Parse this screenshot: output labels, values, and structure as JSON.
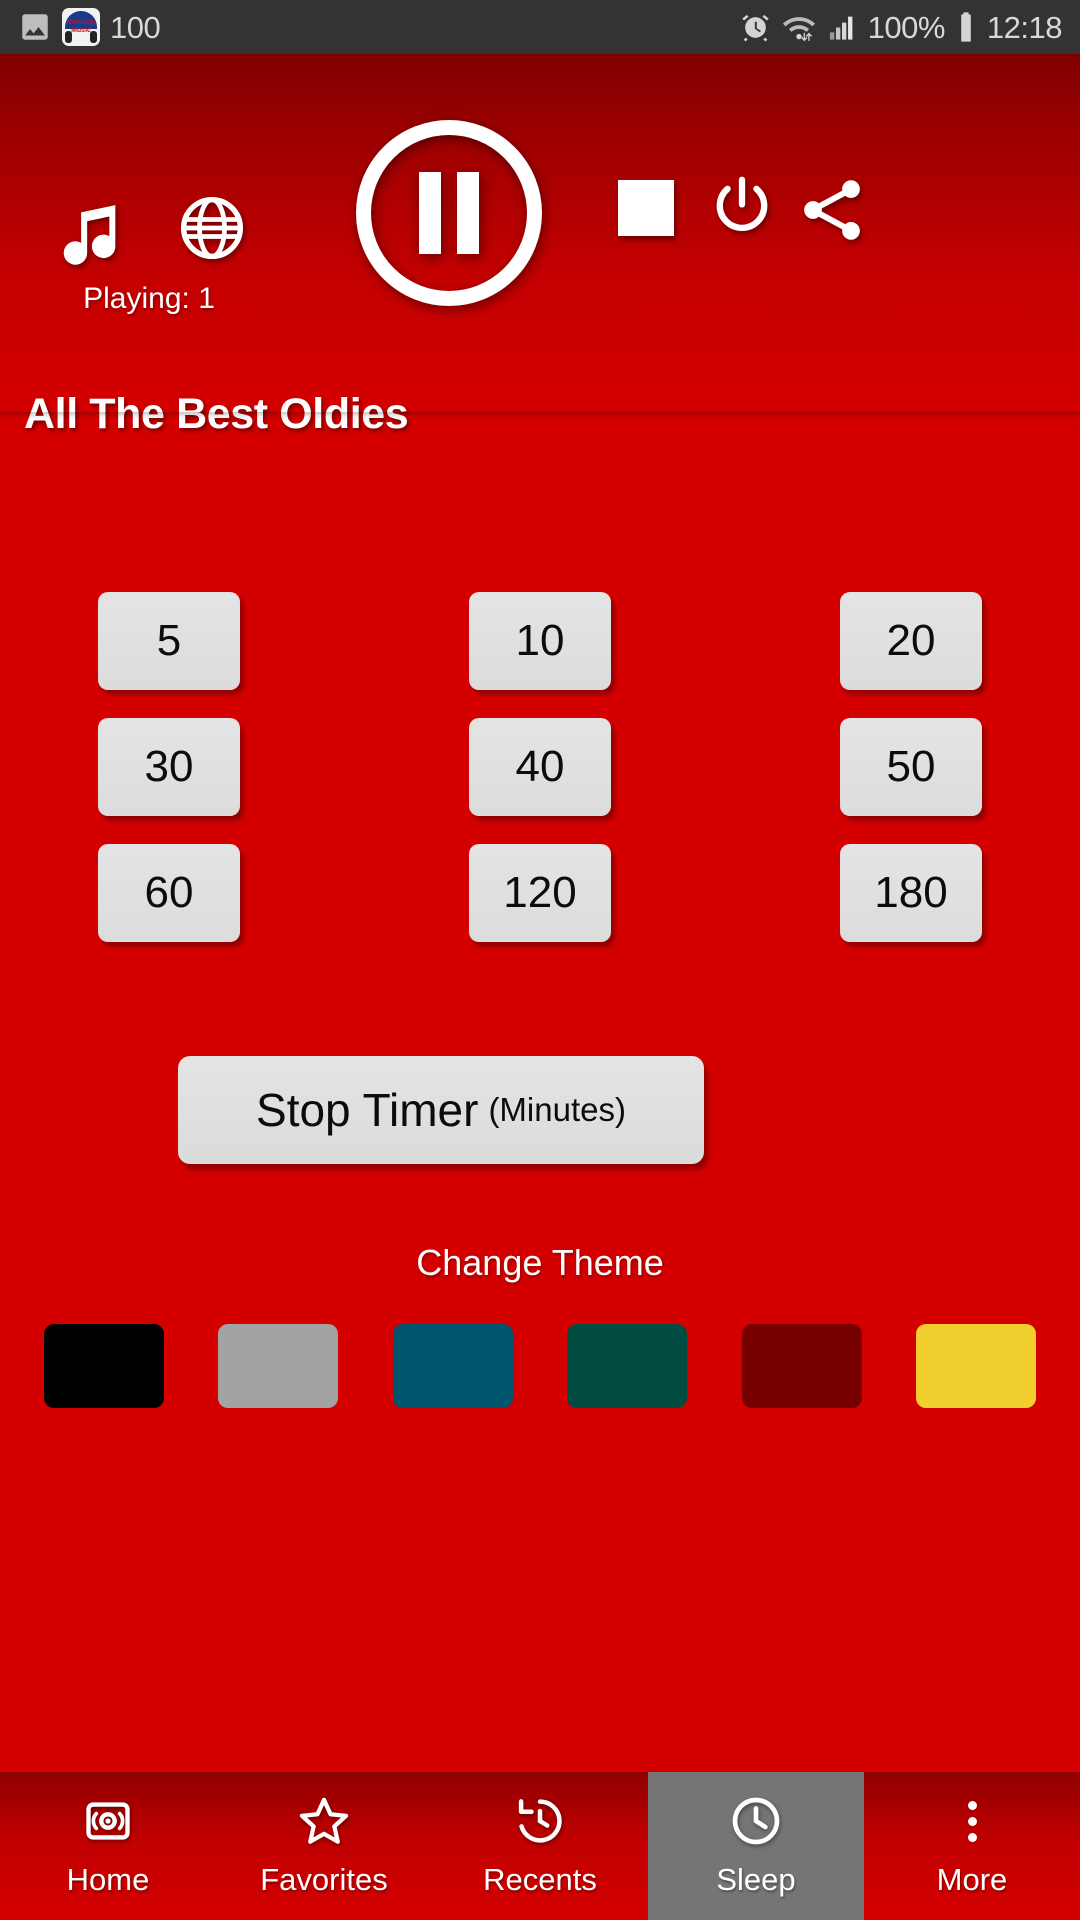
{
  "status_bar": {
    "left_icons": [
      "image-icon",
      "nonstop-music-app-icon"
    ],
    "app_badge_text": "Nonstop Music",
    "notification_count": "100",
    "right_icons": [
      "alarm-icon",
      "wifi-icon",
      "signal-icon",
      "battery-icon"
    ],
    "battery_percent": "100%",
    "clock": "12:18",
    "background": "#333333"
  },
  "player": {
    "music_icon": "music-note-icon",
    "globe_icon": "globe-icon",
    "playing_label": "Playing: 1",
    "play_button": "pause-button",
    "stop_icon": "stop-square-icon",
    "power_icon": "power-icon",
    "share_icon": "share-icon",
    "station_title": "All The Best Oldies",
    "gradient_top": "#7e0000",
    "gradient_bottom": "#d40000"
  },
  "timer": {
    "options": [
      "5",
      "10",
      "20",
      "30",
      "40",
      "50",
      "60",
      "120",
      "180"
    ],
    "stop_button_main": "Stop Timer",
    "stop_button_unit": "(Minutes)",
    "button_face": "#e0e0e0",
    "button_text": "#0c0c0c"
  },
  "theme": {
    "label": "Change Theme",
    "swatches": [
      {
        "name": "black",
        "color": "#000000"
      },
      {
        "name": "gray",
        "color": "#a3a3a3"
      },
      {
        "name": "steel-blue",
        "color": "#00566f"
      },
      {
        "name": "dark-teal",
        "color": "#004c40"
      },
      {
        "name": "dark-red",
        "color": "#760000"
      },
      {
        "name": "yellow",
        "color": "#f0cf2e"
      }
    ]
  },
  "bottom_nav": {
    "active": "Sleep",
    "active_background": "#757575",
    "items": [
      {
        "label": "Home",
        "icon": "radio-icon"
      },
      {
        "label": "Favorites",
        "icon": "star-icon"
      },
      {
        "label": "Recents",
        "icon": "history-clock-icon"
      },
      {
        "label": "Sleep",
        "icon": "clock-icon"
      },
      {
        "label": "More",
        "icon": "overflow-dots-icon"
      }
    ]
  },
  "app_background": "#d40000"
}
